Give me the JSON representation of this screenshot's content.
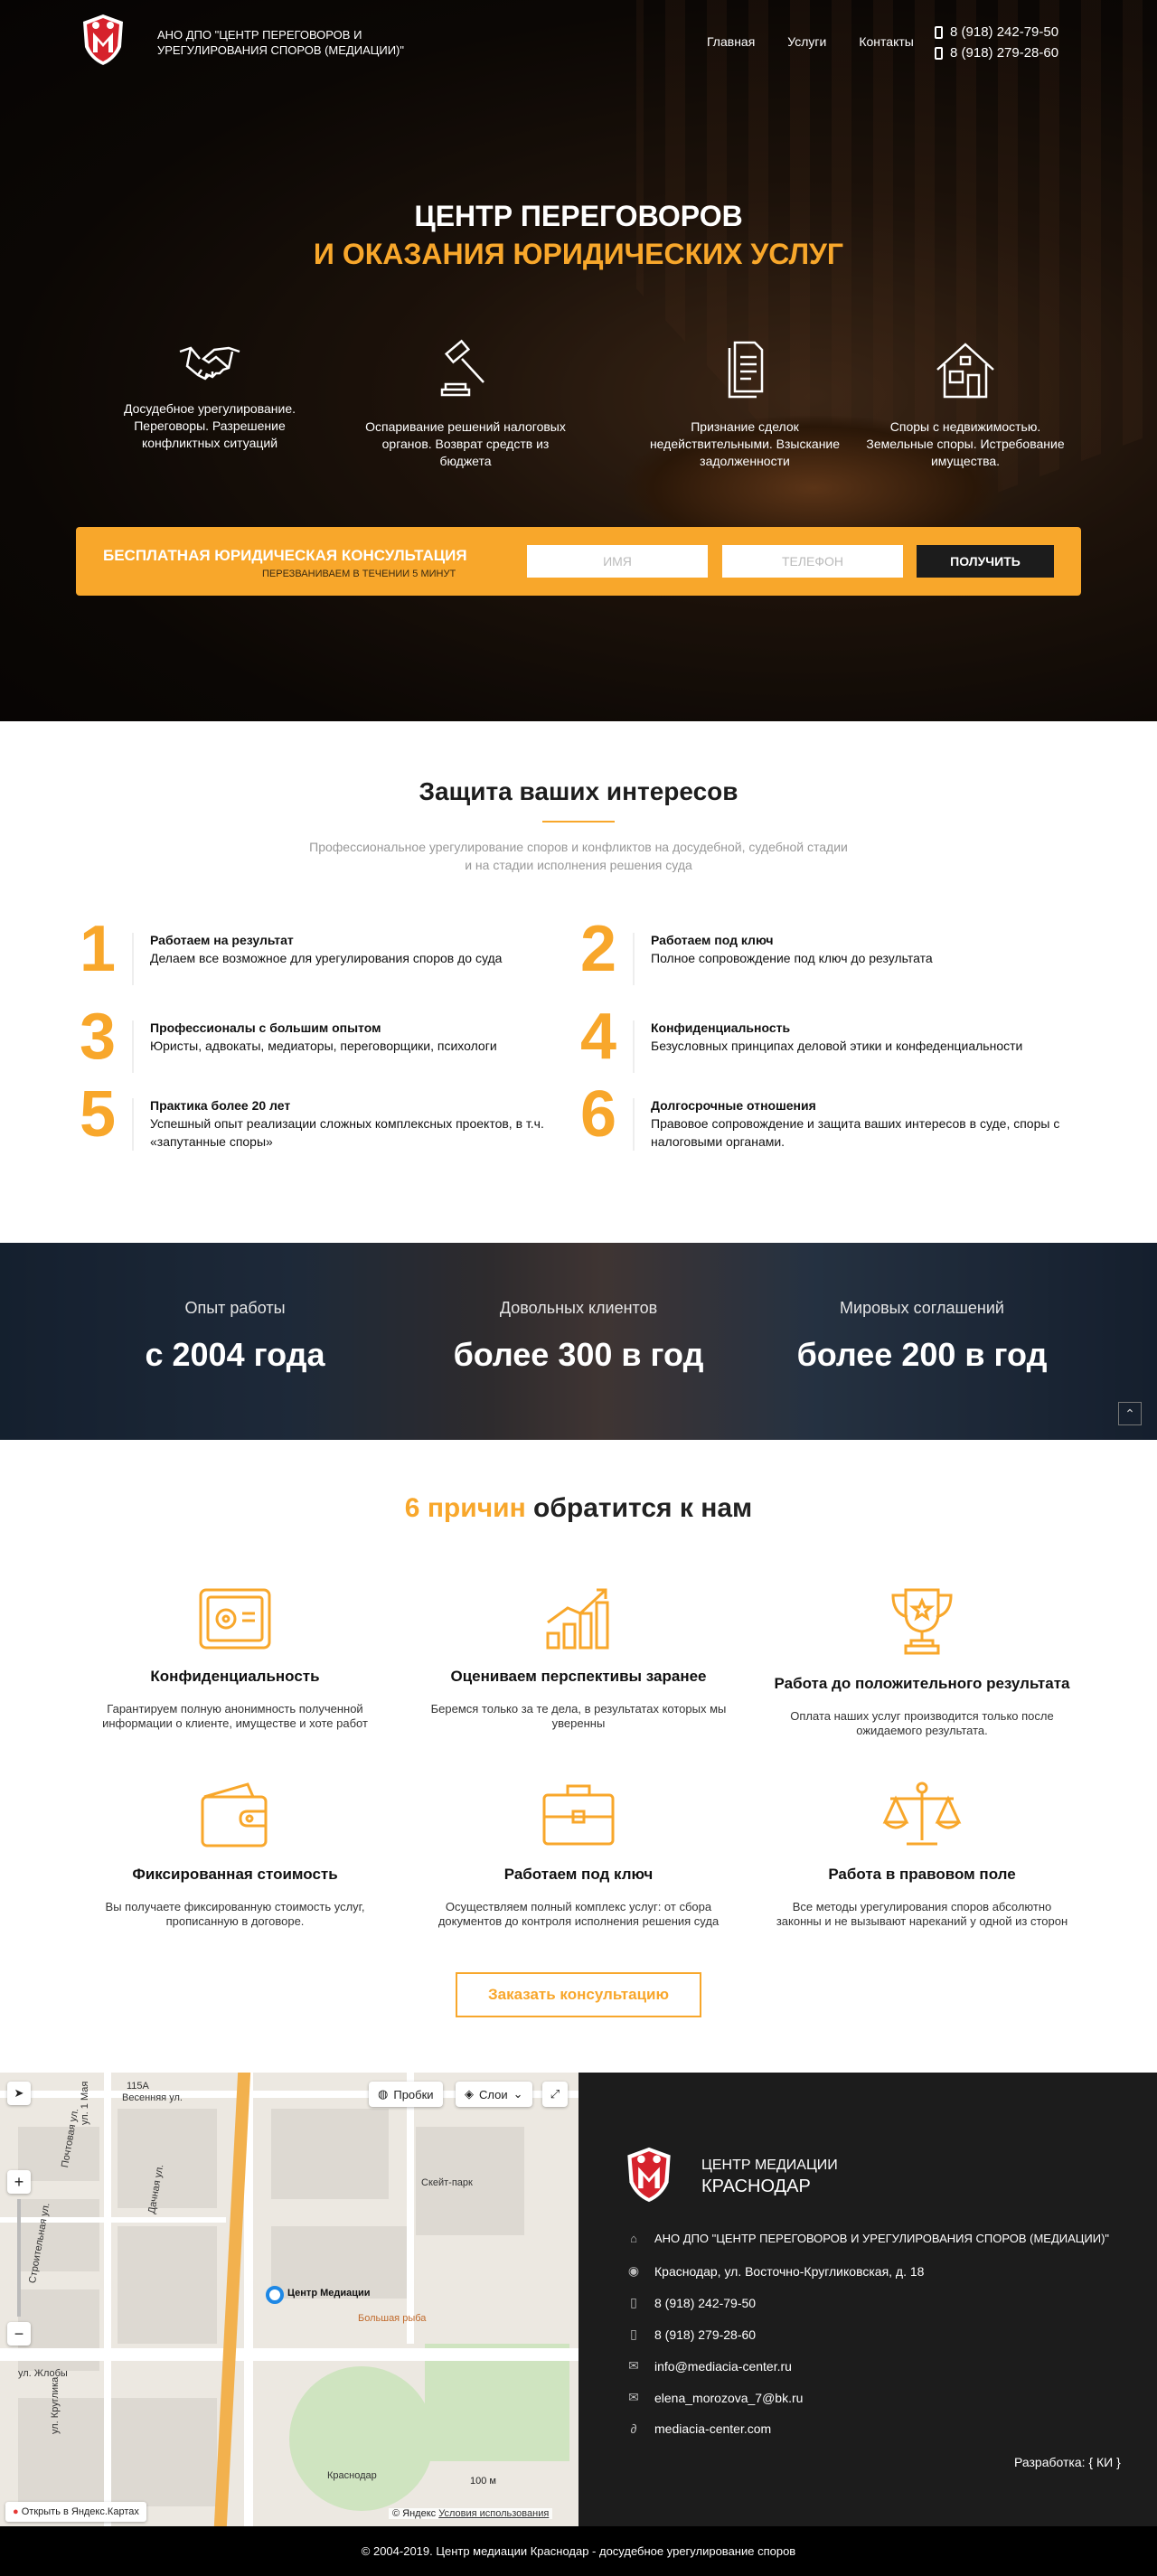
{
  "header": {
    "brand": "АНО ДПО \"ЦЕНТР ПЕРЕГОВОРОВ И УРЕГУЛИРОВАНИЯ СПОРОВ (МЕДИАЦИИ)\"",
    "nav": [
      "Главная",
      "Услуги",
      "Контакты"
    ],
    "phones": [
      "8 (918) 242-79-50",
      "8 (918) 279-28-60"
    ]
  },
  "hero": {
    "title_line1": "ЦЕНТР ПЕРЕГОВОРОВ",
    "title_line2": "И ОКАЗАНИЯ ЮРИДИЧЕСКИХ УСЛУГ",
    "features": [
      {
        "icon": "handshake-icon",
        "text": "Досудебное урегулирование. Переговоры. Разрешение конфликтных ситуаций"
      },
      {
        "icon": "gavel-icon",
        "text": "Оспаривание решений налоговых органов. Возврат средств из бюджета"
      },
      {
        "icon": "documents-icon",
        "text": "Признание сделок недействительными. Взыскание задолженности"
      },
      {
        "icon": "house-icon",
        "text": "Споры с недвижимостью. Земельные споры. Истребование имущества."
      }
    ]
  },
  "consult": {
    "title": "БЕСПЛАТНАЯ ЮРИДИЧЕСКАЯ КОНСУЛЬТАЦИЯ",
    "subtitle": "ПЕРЕЗВАНИВАЕМ В ТЕЧЕНИИ 5 МИНУТ",
    "name_placeholder": "ИМЯ",
    "phone_placeholder": "ТЕЛЕФОН",
    "button": "ПОЛУЧИТЬ"
  },
  "protection": {
    "title": "Защита ваших интересов",
    "subtitle": "Профессиональное урегулирование споров и конфликтов на досудебной, судебной стадии и на стадии исполнения решения суда",
    "items": [
      {
        "num": "1",
        "title": "Работаем на результат",
        "text": "Делаем все возможное для урегулирования споров до суда"
      },
      {
        "num": "2",
        "title": "Работаем под ключ",
        "text": "Полное сопровождение под ключ до результата"
      },
      {
        "num": "3",
        "title": "Профессионалы с большим опытом",
        "text": "Юристы, адвокаты, медиаторы, переговорщики, психологи"
      },
      {
        "num": "4",
        "title": "Конфиденциальность",
        "text": "Безусловных принципах деловой этики и конфеденциальности"
      },
      {
        "num": "5",
        "title": "Практика более 20 лет",
        "text": "Успешный опыт реализации сложных комплексных проектов, в т.ч. «запутанные споры»"
      },
      {
        "num": "6",
        "title": "Долгосрочные отношения",
        "text": "Правовое сопровождение и защита ваших интересов в суде, споры с налоговыми органами."
      }
    ]
  },
  "stats": [
    {
      "label": "Опыт работы",
      "value": "с 2004 года"
    },
    {
      "label": "Довольных клиентов",
      "value": "более 300 в год"
    },
    {
      "label": "Мировых соглашений",
      "value": "более 200 в год"
    }
  ],
  "reasons": {
    "title_accent": "6 причин",
    "title_rest": " обратится к нам",
    "items": [
      {
        "icon": "safe-icon",
        "title": "Конфиденциальность",
        "text": "Гарантируем полную анонимность полученной информации о клиенте, имуществе и хоте работ"
      },
      {
        "icon": "growth-chart-icon",
        "title": "Оцениваем перспективы заранее",
        "text": "Беремся только за те дела, в результатах которых мы уверенны"
      },
      {
        "icon": "trophy-icon",
        "title": "Работа до положительного результата",
        "text": "Оплата наших услуг производится только после ожидаемого результата."
      },
      {
        "icon": "wallet-icon",
        "title": "Фиксированная стоимость",
        "text": "Вы получаете фиксированную стоимость услуг, прописанную в договоре."
      },
      {
        "icon": "briefcase-icon",
        "title": "Работаем под ключ",
        "text": "Осуществляем полный комплекс услуг: от сбора документов до контроля исполнения решения суда"
      },
      {
        "icon": "scales-icon",
        "title": "Работа в правовом поле",
        "text": "Все методы урегулирования споров абсолютно законны и не вызывают нареканий у одной из сторон"
      }
    ],
    "button": "Заказать консультацию"
  },
  "map": {
    "traffic": "Пробки",
    "layers": "Слои",
    "marker": "Центр Медиации",
    "open_link": "Открыть в Яндекс.Картах",
    "scale": "100 м",
    "copyright": "© Яндекс",
    "terms": "Условия использования",
    "labels": [
      "Весенняя ул.",
      "ул. 1 Мая",
      "Скейт-парк",
      "Большая рыба",
      "ул. Жлобы",
      "Краснодар",
      "Дачная ул.",
      "ул. Круглика",
      "Строительная ул.",
      "Почтовая ул.",
      "115А"
    ]
  },
  "footer": {
    "brand_line1": "ЦЕНТР МЕДИАЦИИ",
    "brand_line2": "КРАСНОДАР",
    "org": "АНО ДПО \"ЦЕНТР ПЕРЕГОВОРОВ И УРЕГУЛИРОВАНИЯ СПОРОВ (МЕДИАЦИИ)\"",
    "address": "Краснодар, ул. Восточно-Кругликовская, д. 18",
    "phone1": "8 (918) 242-79-50",
    "phone2": "8 (918) 279-28-60",
    "email1": "info@mediacia-center.ru",
    "email2": "elena_morozova_7@bk.ru",
    "site": "mediacia-center.com",
    "dev": "Разработка: { КИ }"
  },
  "copyright": "© 2004-2019. Центр медиации Краснодар - досудебное урегулирование споров",
  "colors": {
    "accent": "#f8a72b",
    "dark": "#1c1c1c",
    "logo_red": "#d6222c"
  }
}
